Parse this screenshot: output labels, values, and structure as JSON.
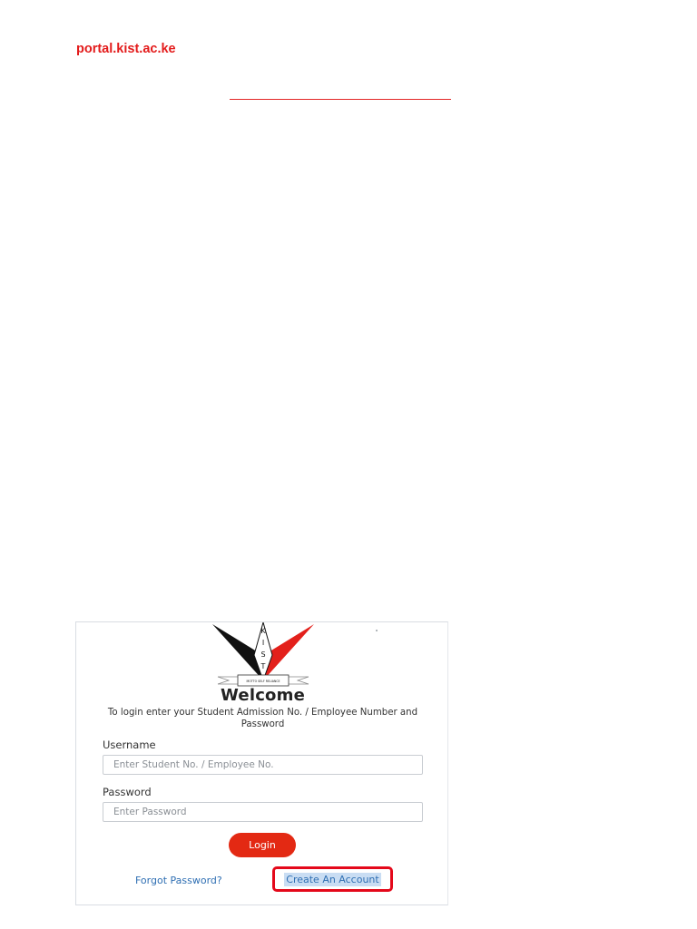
{
  "header": {
    "site_url": "portal.kist.ac.ke"
  },
  "login": {
    "logo": {
      "name": "kist-logo",
      "letters": [
        "K",
        "I",
        "S",
        "T"
      ],
      "banner_text": "MOTTO SELF RELIANCE"
    },
    "welcome": "Welcome",
    "instructions": "To login enter your Student Admission No. / Employee Number and Password",
    "username_label": "Username",
    "username_placeholder": "Enter Student No. / Employee No.",
    "username_value": "",
    "password_label": "Password",
    "password_placeholder": "Enter Password",
    "password_value": "",
    "login_button": "Login",
    "forgot_password": "Forgot Password?",
    "create_account": "Create An Account"
  },
  "colors": {
    "brand_red": "#e31b1b",
    "link_blue": "#2f6fb3",
    "highlight_box": "#e4081a",
    "link_highlight_bg": "#c9ddf3"
  }
}
